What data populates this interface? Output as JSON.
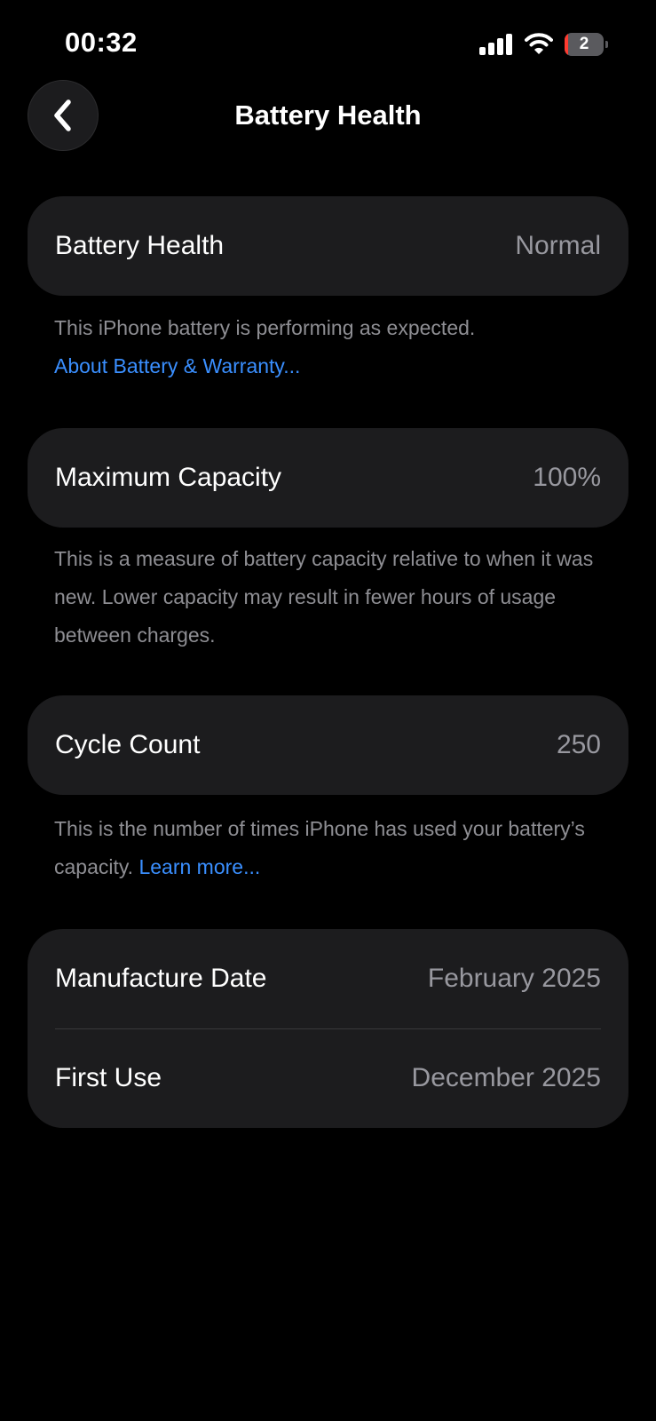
{
  "status_bar": {
    "time": "00:32",
    "battery_level": "2",
    "battery_fraction": 0.02,
    "battery_fill_color": "#ff3b30",
    "icons": [
      "cellular-signal-icon",
      "wifi-icon",
      "battery-icon"
    ]
  },
  "nav": {
    "back_icon": "chevron-left-icon",
    "title": "Battery Health"
  },
  "battery_health": {
    "label": "Battery Health",
    "value": "Normal",
    "description": "This iPhone battery is performing as expected.",
    "link": "About Battery & Warranty..."
  },
  "maximum_capacity": {
    "label": "Maximum Capacity",
    "value": "100%",
    "description": "This is a measure of battery capacity relative to when it was new. Lower capacity may result in fewer hours of usage between charges."
  },
  "cycle_count": {
    "label": "Cycle Count",
    "value": "250",
    "description": "This is the number of times iPhone has used your battery’s capacity.",
    "link": "Learn more..."
  },
  "dates": {
    "manufacture_label": "Manufacture Date",
    "manufacture_value": "February 2025",
    "first_use_label": "First Use",
    "first_use_value": "December 2025"
  },
  "colors": {
    "background": "#000000",
    "card": "#1c1c1e",
    "secondary_text": "#8e8e93",
    "link": "#3a8fff"
  }
}
